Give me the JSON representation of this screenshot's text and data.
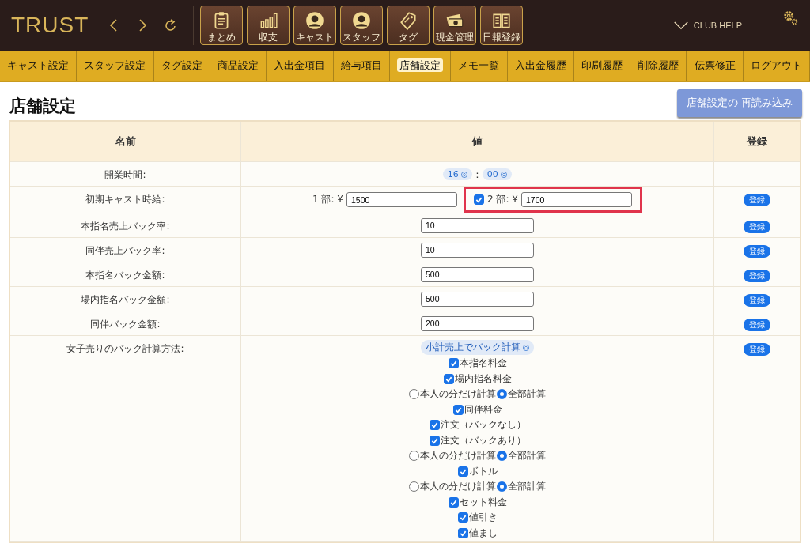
{
  "header": {
    "logo": "TRUST",
    "icon_buttons": [
      {
        "label": "まとめ"
      },
      {
        "label": "収支"
      },
      {
        "label": "キャスト"
      },
      {
        "label": "スタッフ"
      },
      {
        "label": "タグ"
      },
      {
        "label": "現金管理"
      },
      {
        "label": "日報登録"
      }
    ],
    "help_link": "CLUB HELP"
  },
  "nav_tabs": [
    {
      "label": "キャスト設定",
      "selected": false
    },
    {
      "label": "スタッフ設定",
      "selected": false
    },
    {
      "label": "タグ設定",
      "selected": false
    },
    {
      "label": "商品設定",
      "selected": false
    },
    {
      "label": "入出金項目",
      "selected": false
    },
    {
      "label": "給与項目",
      "selected": false
    },
    {
      "label": "店舗設定",
      "selected": true
    },
    {
      "label": "メモ一覧",
      "selected": false
    },
    {
      "label": "入出金履歴",
      "selected": false
    },
    {
      "label": "印刷履歴",
      "selected": false
    },
    {
      "label": "削除履歴",
      "selected": false
    },
    {
      "label": "伝票修正",
      "selected": false
    },
    {
      "label": "ログアウト",
      "selected": false
    }
  ],
  "page_title": "店舗設定",
  "reload_button": "店舗設定の 再読み込み",
  "table": {
    "columns": [
      "名前",
      "値",
      "登録"
    ],
    "rows": [
      {
        "kind": "time",
        "name": "開業時間:",
        "hour": "16",
        "minute": "00",
        "separator": ":"
      },
      {
        "kind": "dual",
        "name": "初期キャスト時給:",
        "register": "登録",
        "first": {
          "label": "1 部: ¥",
          "value": "1500"
        },
        "second": {
          "label": "2 部: ¥",
          "value": "1700",
          "checked": true,
          "highlighted": true
        }
      },
      {
        "kind": "input",
        "name": "本指名売上バック率:",
        "value": "10",
        "register": "登録"
      },
      {
        "kind": "input",
        "name": "同伴売上バック率:",
        "value": "10",
        "register": "登録"
      },
      {
        "kind": "input",
        "name": "本指名バック金額:",
        "value": "500",
        "register": "登録"
      },
      {
        "kind": "input",
        "name": "場内指名バック金額:",
        "value": "500",
        "register": "登録"
      },
      {
        "kind": "input",
        "name": "同伴バック金額:",
        "value": "200",
        "register": "登録"
      },
      {
        "kind": "options",
        "name": "女子売りのバック計算方法:",
        "register": "登録",
        "select": "小計売上でバック計算",
        "items": [
          {
            "kind": "checkbox",
            "label": "本指名料金",
            "checked": true
          },
          {
            "kind": "checkbox",
            "label": "場内指名料金",
            "checked": true
          },
          {
            "kind": "radio_pair",
            "options": [
              {
                "label": "本人の分だけ計算",
                "selected": false
              },
              {
                "label": "全部計算",
                "selected": true
              }
            ]
          },
          {
            "kind": "checkbox",
            "label": "同伴料金",
            "checked": true
          },
          {
            "kind": "checkbox",
            "label": "注文（バックなし）",
            "checked": true
          },
          {
            "kind": "checkbox",
            "label": "注文（バックあり）",
            "checked": true
          },
          {
            "kind": "radio_pair",
            "options": [
              {
                "label": "本人の分だけ計算",
                "selected": false
              },
              {
                "label": "全部計算",
                "selected": true
              }
            ]
          },
          {
            "kind": "checkbox",
            "label": "ボトル",
            "checked": true
          },
          {
            "kind": "radio_pair",
            "options": [
              {
                "label": "本人の分だけ計算",
                "selected": false
              },
              {
                "label": "全部計算",
                "selected": true
              }
            ]
          },
          {
            "kind": "checkbox",
            "label": "セット料金",
            "checked": true
          },
          {
            "kind": "checkbox",
            "label": "値引き",
            "checked": true
          },
          {
            "kind": "checkbox",
            "label": "値まし",
            "checked": true
          }
        ]
      }
    ]
  }
}
